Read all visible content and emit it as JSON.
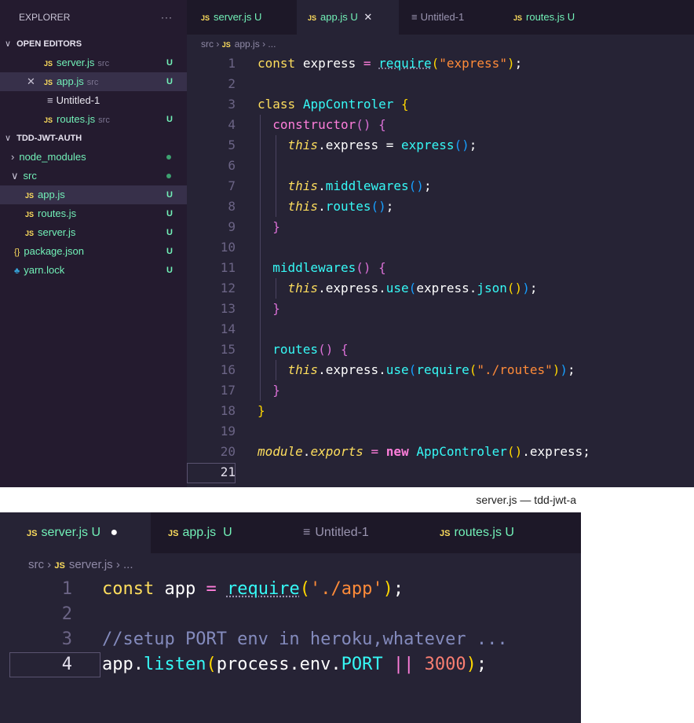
{
  "window_title": "server.js — tdd-jwt-a",
  "top": {
    "explorer": {
      "title": "EXPLORER",
      "more": "···",
      "open_editors_label": "OPEN EDITORS",
      "open_editors": [
        {
          "name": "server.js",
          "dir": "src",
          "status": "U"
        },
        {
          "name": "app.js",
          "dir": "src",
          "status": "U"
        },
        {
          "name": "Untitled-1",
          "dir": "",
          "status": ""
        },
        {
          "name": "routes.js",
          "dir": "src",
          "status": "U"
        }
      ],
      "project_label": "TDD-JWT-AUTH",
      "tree": [
        {
          "name": "node_modules",
          "status": ""
        },
        {
          "name": "src",
          "status": ""
        },
        {
          "name": "app.js",
          "status": "U"
        },
        {
          "name": "routes.js",
          "status": "U"
        },
        {
          "name": "server.js",
          "status": "U"
        },
        {
          "name": "package.json",
          "status": "U"
        },
        {
          "name": "yarn.lock",
          "status": "U"
        }
      ]
    },
    "tabs": [
      {
        "name": "server.js",
        "status": "U"
      },
      {
        "name": "app.js",
        "status": "U"
      },
      {
        "name": "Untitled-1",
        "status": ""
      },
      {
        "name": "routes.js",
        "status": "U"
      }
    ],
    "breadcrumb": {
      "folder": "src",
      "file": "app.js",
      "rest": "..."
    },
    "line_numbers": [
      "1",
      "2",
      "3",
      "4",
      "5",
      "6",
      "7",
      "8",
      "9",
      "10",
      "11",
      "12",
      "13",
      "14",
      "15",
      "16",
      "17",
      "18",
      "19",
      "20",
      "21"
    ],
    "code": {
      "l1_const": "const",
      "l1_name": "express",
      "l1_eq": "=",
      "l1_require": "require",
      "l1_str": "\"express\"",
      "l1_end": ";",
      "l3_class": "class",
      "l3_name": "AppControler",
      "l4_ctor": "constructor",
      "l5_this": "this",
      "l5_prop": ".express",
      "l5_eq": " = ",
      "l5_call": "express",
      "l7_this": "this",
      "l7_call": "middlewares",
      "l8_this": "this",
      "l8_call": "routes",
      "l11_fn": "middlewares",
      "l12_this": "this",
      "l12_prop": ".express.",
      "l12_use": "use",
      "l12_express": "express",
      "l12_json": "json",
      "l15_fn": "routes",
      "l16_this": "this",
      "l16_prop": ".express.",
      "l16_use": "use",
      "l16_require": "require",
      "l16_str": "\"./routes\"",
      "l20_module": "module",
      "l20_exports": "exports",
      "l20_new": "new",
      "l20_cls": "AppControler",
      "l20_express": ".express"
    }
  },
  "bottom": {
    "tabs": [
      {
        "name": "server.js",
        "status": "U"
      },
      {
        "name": "app.js",
        "status": "U"
      },
      {
        "name": "Untitled-1",
        "status": ""
      },
      {
        "name": "routes.js",
        "status": "U"
      }
    ],
    "breadcrumb": {
      "folder": "src",
      "file": "server.js",
      "rest": "..."
    },
    "line_numbers": [
      "1",
      "2",
      "3",
      "4"
    ],
    "code": {
      "l1_const": "const",
      "l1_name": "app",
      "l1_eq": "=",
      "l1_require": "require",
      "l1_str": "'./app'",
      "l1_end": ";",
      "l3_comment": "//setup PORT env in heroku,whatever ...",
      "l4_app": "app.",
      "l4_listen": "listen",
      "l4_process": "process.env.",
      "l4_port": "PORT",
      "l4_or": "||",
      "l4_num": "3000",
      "l4_end": ";"
    }
  },
  "colors": {
    "editor_bg": "#262335",
    "sidebar_bg": "#241b2f",
    "untracked": "#72f1b8",
    "keyword": "#fede5d"
  }
}
